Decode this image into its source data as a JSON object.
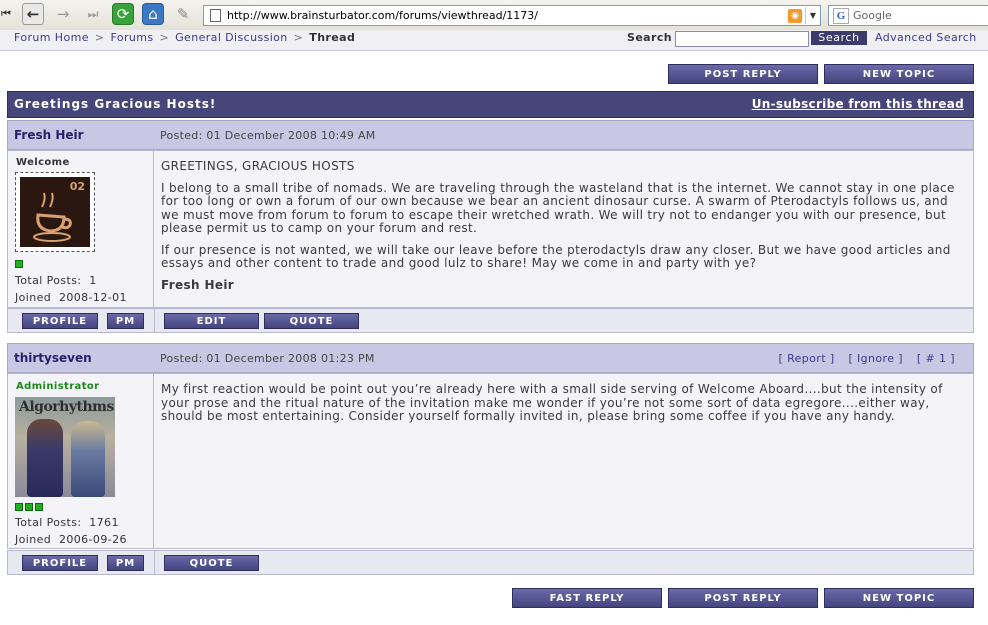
{
  "browser": {
    "url": "http://www.brainsturbator.com/forums/viewthread/1173/",
    "search_placeholder": "Google"
  },
  "breadcrumb": {
    "items": [
      "Forum Home",
      "Forums",
      "General Discussion"
    ],
    "current": "Thread",
    "separator": ">"
  },
  "forum_search": {
    "label": "Search",
    "button": "Search",
    "advanced": "Advanced Search"
  },
  "actions": {
    "post_reply": "POST REPLY",
    "new_topic": "NEW TOPIC",
    "fast_reply": "FAST REPLY"
  },
  "thread": {
    "title": "Greetings Gracious Hosts!",
    "unsubscribe": "Un-subscribe from this thread"
  },
  "posts": [
    {
      "author": "Fresh Heir",
      "posted": "Posted: 01 December 2008 10:49 AM",
      "rank": "Welcome",
      "rank_color": "#333333",
      "avatar_icon": "stamp-cup-icon",
      "avatar_label": "02",
      "rank_pips": 1,
      "total_posts_label": "Total Posts:",
      "total_posts": "1",
      "joined_label": "Joined",
      "joined": "2008-12-01",
      "body": [
        "GREETINGS, GRACIOUS HOSTS",
        "I belong to a small tribe of nomads. We are traveling through the wasteland that is the internet. We cannot stay in one place for too long or own a forum of our own because we bear an ancient dinosaur curse. A swarm of Pterodactyls follows us, and we must move from forum to forum to escape their wretched wrath. We will try not to endanger you with our presence, but please permit us to camp on your forum and rest.",
        "If our presence is not wanted, we will take our leave before the pterodactyls draw any closer. But we have good articles and essays and other content to trade and good lulz to share! May we come in and party with ye?"
      ],
      "signature": "Fresh Heir",
      "buttons": {
        "profile": "PROFILE",
        "pm": "PM",
        "edit": "EDIT",
        "quote": "QUOTE"
      }
    },
    {
      "author": "thirtyseven",
      "posted": "Posted: 01 December 2008 01:23 PM",
      "links": {
        "report": "[ Report ]",
        "ignore": "[ Ignore ]",
        "num": "[ # 1 ]"
      },
      "rank": "Administrator",
      "rank_color": "#1a8a1a",
      "avatar_banner": "Algorhythms",
      "rank_pips": 3,
      "total_posts_label": "Total Posts:",
      "total_posts": "1761",
      "joined_label": "Joined",
      "joined": "2006-09-26",
      "body": [
        "My first reaction would be point out you’re already here with a small side serving of Welcome Aboard....but the intensity of your prose and the ritual nature of the invitation make me wonder if you’re not some sort of data egregore....either way, should be most entertaining. Consider yourself formally invited in, please bring some coffee if you have any handy."
      ],
      "buttons": {
        "profile": "PROFILE",
        "pm": "PM",
        "quote": "QUOTE"
      }
    }
  ],
  "colors": {
    "accent": "#46467a",
    "post_header": "#c8c8e4",
    "online_pip": "#1faf1f"
  }
}
